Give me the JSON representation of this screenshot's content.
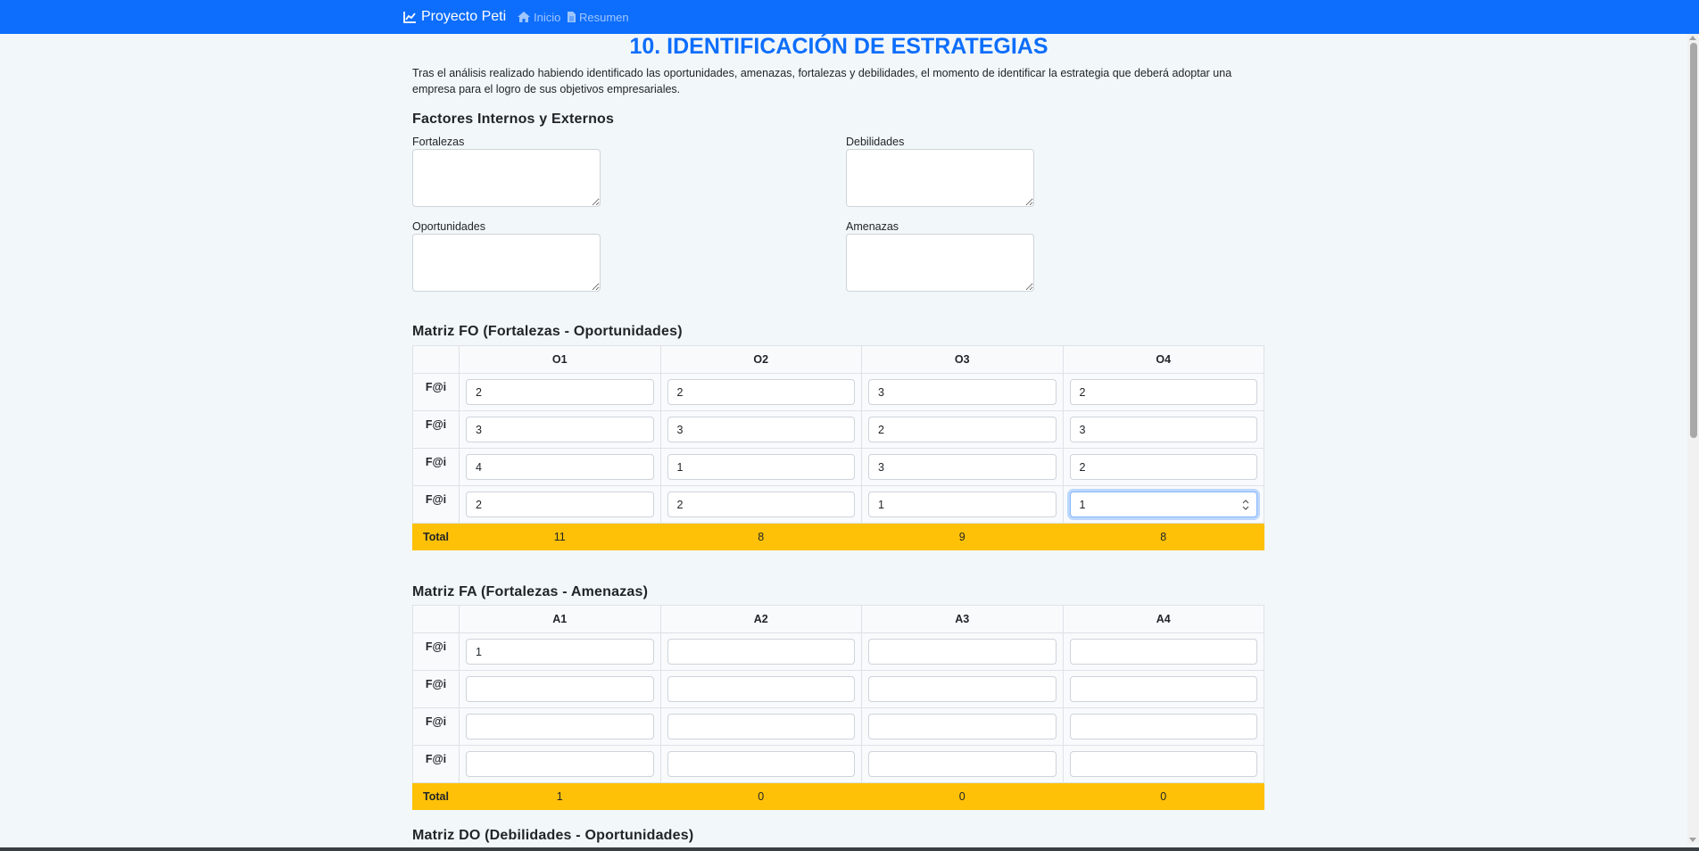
{
  "navbar": {
    "brand": "Proyecto Peti",
    "brand_icon": "chart-line-icon",
    "links": [
      {
        "label": "Inicio",
        "icon": "home-icon"
      },
      {
        "label": "Resumen",
        "icon": "file-icon"
      }
    ],
    "color": "#0d6efd"
  },
  "page": {
    "title": "10. IDENTIFICACIÓN DE ESTRATEGIAS",
    "intro": "Tras el análisis realizado habiendo identificado las oportunidades, amenazas, fortalezas y debilidades, el momento de identificar la estrategia que deberá adoptar una empresa para el logro de sus objetivos empresariales."
  },
  "factors": {
    "heading": "Factores Internos y Externos",
    "fortalezas": {
      "label": "Fortalezas",
      "value": ""
    },
    "debilidades": {
      "label": "Debilidades",
      "value": ""
    },
    "oportunidades": {
      "label": "Oportunidades",
      "value": ""
    },
    "amenazas": {
      "label": "Amenazas",
      "value": ""
    }
  },
  "matrix_fo": {
    "heading": "Matriz FO (Fortalezas - Oportunidades)",
    "columns": [
      "O1",
      "O2",
      "O3",
      "O4"
    ],
    "row_label": "F@i",
    "rows": [
      [
        "2",
        "2",
        "3",
        "2"
      ],
      [
        "3",
        "3",
        "2",
        "3"
      ],
      [
        "4",
        "1",
        "3",
        "2"
      ],
      [
        "2",
        "2",
        "1",
        "1"
      ]
    ],
    "total_label": "Total",
    "totals": [
      "11",
      "8",
      "9",
      "8"
    ]
  },
  "matrix_fa": {
    "heading": "Matriz FA (Fortalezas - Amenazas)",
    "columns": [
      "A1",
      "A2",
      "A3",
      "A4"
    ],
    "row_label": "F@i",
    "rows": [
      [
        "1",
        "",
        "",
        ""
      ],
      [
        "",
        "",
        "",
        ""
      ],
      [
        "",
        "",
        "",
        ""
      ],
      [
        "",
        "",
        "",
        ""
      ]
    ],
    "total_label": "Total",
    "totals": [
      "1",
      "0",
      "0",
      "0"
    ]
  },
  "matrix_do": {
    "heading": "Matriz DO (Debilidades - Oportunidades)"
  },
  "colors": {
    "accent": "#0d6efd",
    "total_row": "#ffc107",
    "background": "#f2f7fa"
  }
}
